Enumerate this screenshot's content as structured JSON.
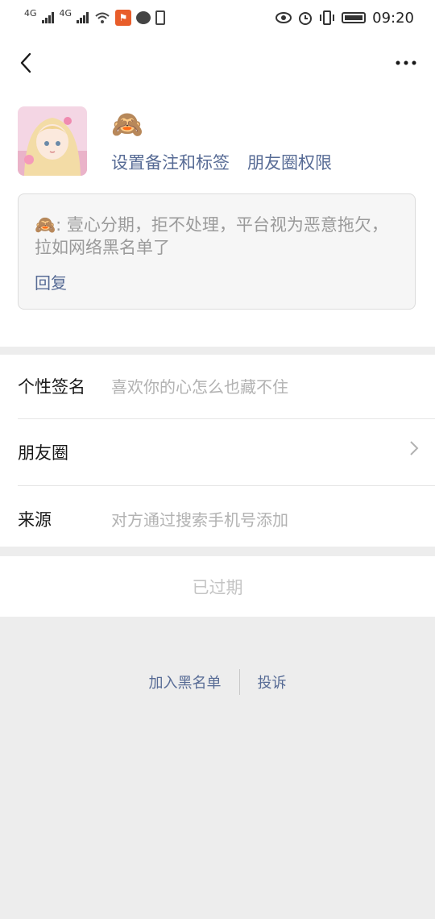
{
  "status_bar": {
    "signal1": "4G",
    "signal2": "4G",
    "time": "09:20"
  },
  "nav": {
    "back_icon": "back-arrow-icon",
    "more_icon": "more-dots-icon"
  },
  "profile": {
    "nickname_emoji": "🙈",
    "link_remark": "设置备注和标签",
    "link_moments_permission": "朋友圈权限"
  },
  "moment": {
    "emoji": "🙈",
    "text": ": 壹心分期，拒不处理，平台视为恶意拖欠，拉如网络黑名单了",
    "reply": "回复"
  },
  "rows": {
    "signature_label": "个性签名",
    "signature_value": "喜欢你的心怎么也藏不住",
    "moments_label": "朋友圈",
    "source_label": "来源",
    "source_value": "对方通过搜索手机号添加"
  },
  "expired_label": "已过期",
  "footer": {
    "blacklist": "加入黑名单",
    "report": "投诉"
  },
  "colors": {
    "link": "#576b95",
    "background": "#ededed",
    "muted": "#b2b2b2"
  }
}
